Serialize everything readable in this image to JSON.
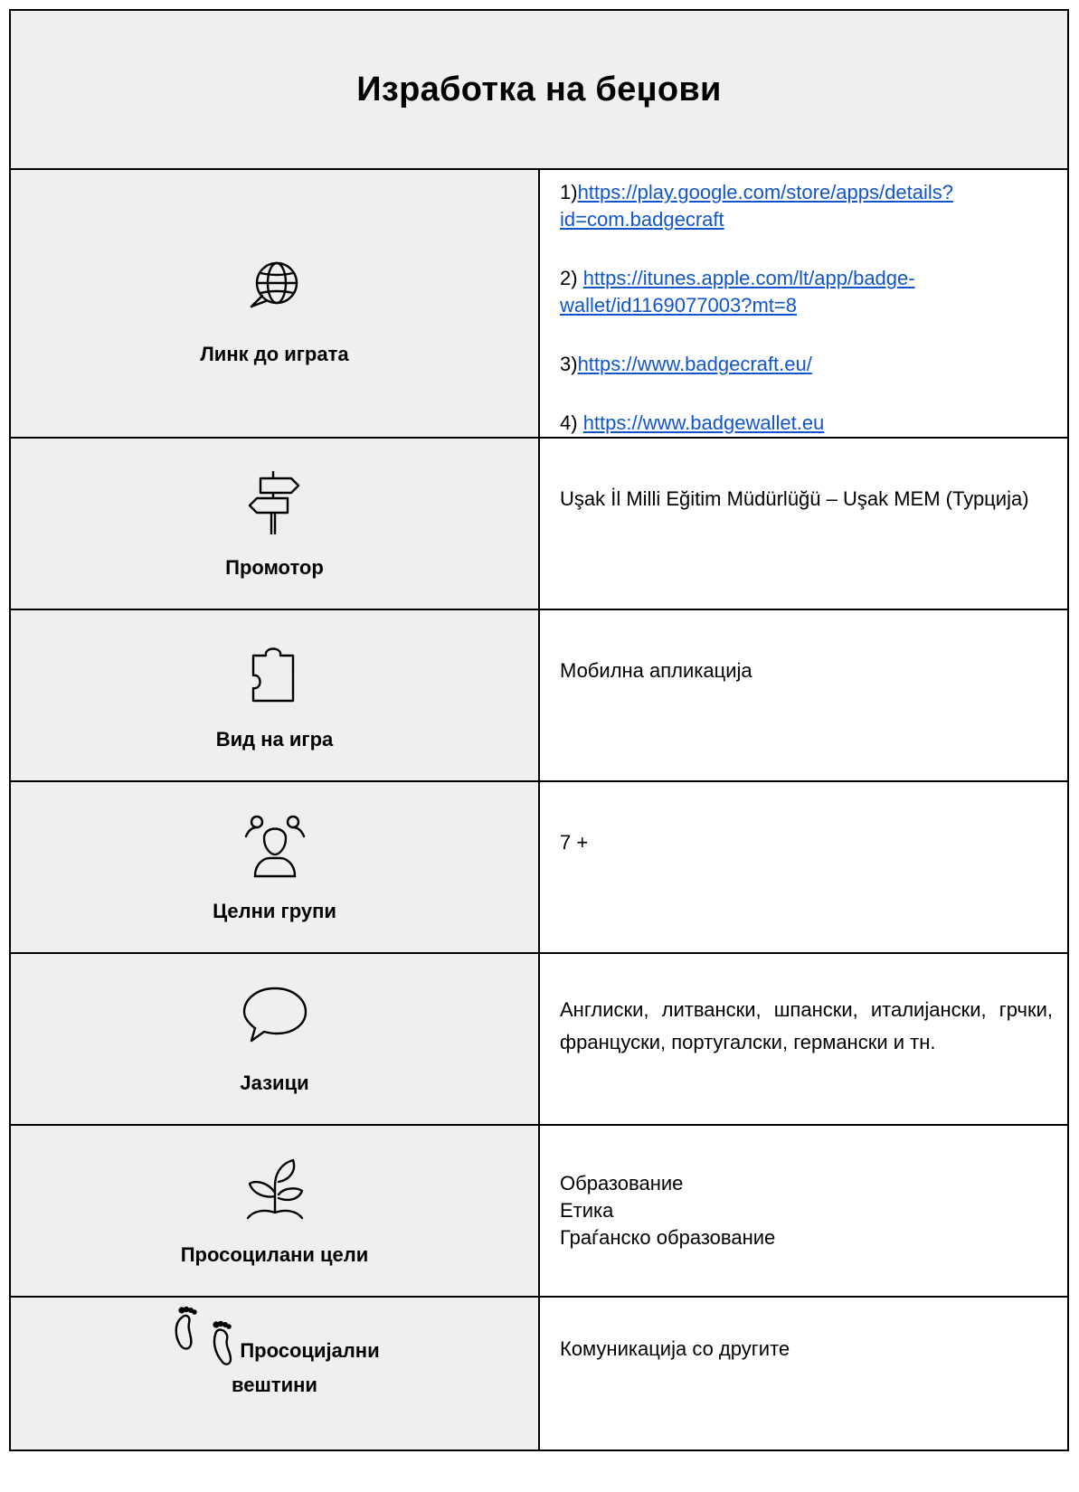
{
  "title": "Изработка на беџови",
  "rows": {
    "link": {
      "label": "Линк до играта",
      "icon": "globe-icon",
      "links": [
        {
          "prefix": "1)",
          "url": "https://play.google.com/store/apps/details?id=com.badgecraft"
        },
        {
          "prefix": "2) ",
          "url": "https://itunes.apple.com/lt/app/badge-wallet/id1169077003?mt=8"
        },
        {
          "prefix": "3)",
          "url": "https://www.badgecraft.eu/"
        },
        {
          "prefix": "4) ",
          "url": "https://www.badgewallet.eu"
        }
      ]
    },
    "promoter": {
      "label": "Промотор",
      "icon": "signpost-icon",
      "value": "Uşak İl Milli Eğitim Müdürlüğü – Uşak MEM (Турција)"
    },
    "type": {
      "label": "Вид на игра",
      "icon": "puzzle-piece-icon",
      "value": "Мобилна апликација"
    },
    "target": {
      "label": "Целни групи",
      "icon": "people-group-icon",
      "value": "7 +"
    },
    "languages": {
      "label": "Јазици",
      "icon": "speech-bubble-icon",
      "value": "Англиски, литвански, шпански, италијански, грчки, француски, португалски, германски и тн."
    },
    "goals": {
      "label": "Просоцилани цели",
      "icon": "sprout-icon",
      "values": [
        "Образование",
        "Етика",
        "Граѓанско образование"
      ]
    },
    "skills": {
      "label_line1": "Просоцијални",
      "label_line2": "вештини",
      "icon": "footprints-icon",
      "value": "Комуникација со другите"
    }
  }
}
